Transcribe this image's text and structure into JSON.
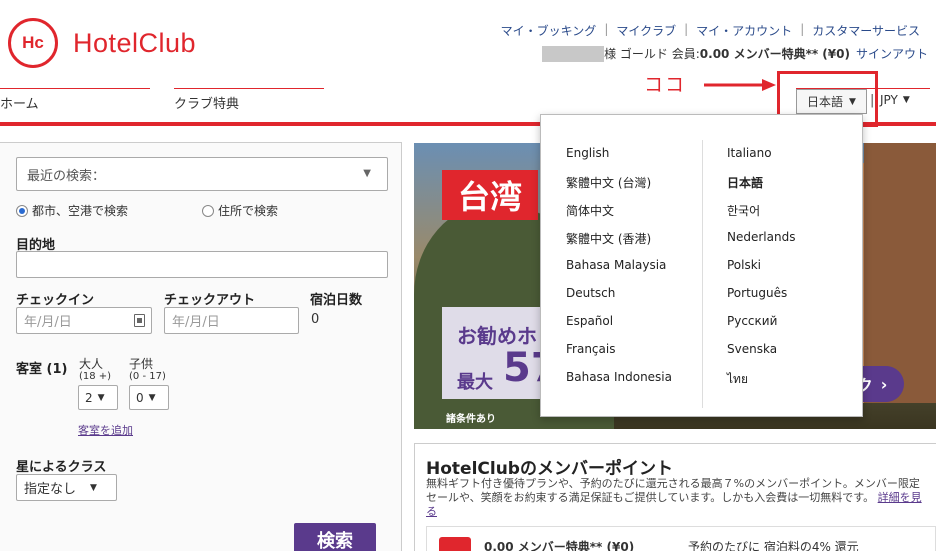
{
  "brand": {
    "mark": "Hc",
    "name": "HotelClub",
    "color": "#e0262d",
    "accent": "#5a3a8c"
  },
  "top_links": [
    "マイ・ブッキング",
    "マイクラブ",
    "マイ・アカウント",
    "カスタマーサービス"
  ],
  "member": {
    "suffix": "様 ゴールド 会員:",
    "points": "0.00 メンバー特典** (¥0)",
    "signout": "サインアウト"
  },
  "nav": {
    "home": "ホーム",
    "club_benefits": "クラブ特典"
  },
  "language": {
    "current": "日本語",
    "currency": "JPY"
  },
  "annotation": {
    "text": "ココ"
  },
  "language_menu": {
    "left": [
      "English",
      "繁體中文 (台灣)",
      "简体中文",
      "繁體中文 (香港)",
      "Bahasa Malaysia",
      "Deutsch",
      "Español",
      "Français",
      "Bahasa Indonesia"
    ],
    "right": [
      "Italiano",
      "日本語",
      "한국어",
      "Nederlands",
      "Polski",
      "Português",
      "Русский",
      "Svenska",
      "ไทย"
    ]
  },
  "search": {
    "recent": "最近の検索：",
    "radio_city": "都市、空港で検索",
    "radio_address": "住所で検索",
    "destination_label": "目的地",
    "destination_value": "",
    "checkin_label": "チェックイン",
    "checkout_label": "チェックアウト",
    "date_placeholder": "年/月/日",
    "nights_label": "宿泊日数",
    "nights_value": "0",
    "rooms_label": "客室 (1)",
    "adults_label": "大人",
    "adults_range": "(18 +)",
    "children_label": "子供",
    "children_range": "(0 - 17)",
    "adults_value": "2",
    "children_value": "0",
    "add_room": "客室を追加",
    "star_label": "星によるクラス",
    "star_value": "指定なし",
    "submit": "検索"
  },
  "promo": {
    "tag": "台湾",
    "line1": "お勧めホ",
    "line2": "最大",
    "big": "57",
    "note": "諸条件あり",
    "cta": "ク"
  },
  "points_box": {
    "title": "HotelClubのメンバーポイント",
    "desc": "無料ギフト付き優待プランや、予約のたびに還元される最高７%のメンバーポイント。メンバー限定セールや、笑顔をお約束する満足保証もご提供しています。しかも入会費は一切無料です。",
    "more": "詳細を見る",
    "value": "0.00 メンバー特典** (¥0)",
    "rate": "予約のたびに 宿泊料の4% 還元"
  }
}
